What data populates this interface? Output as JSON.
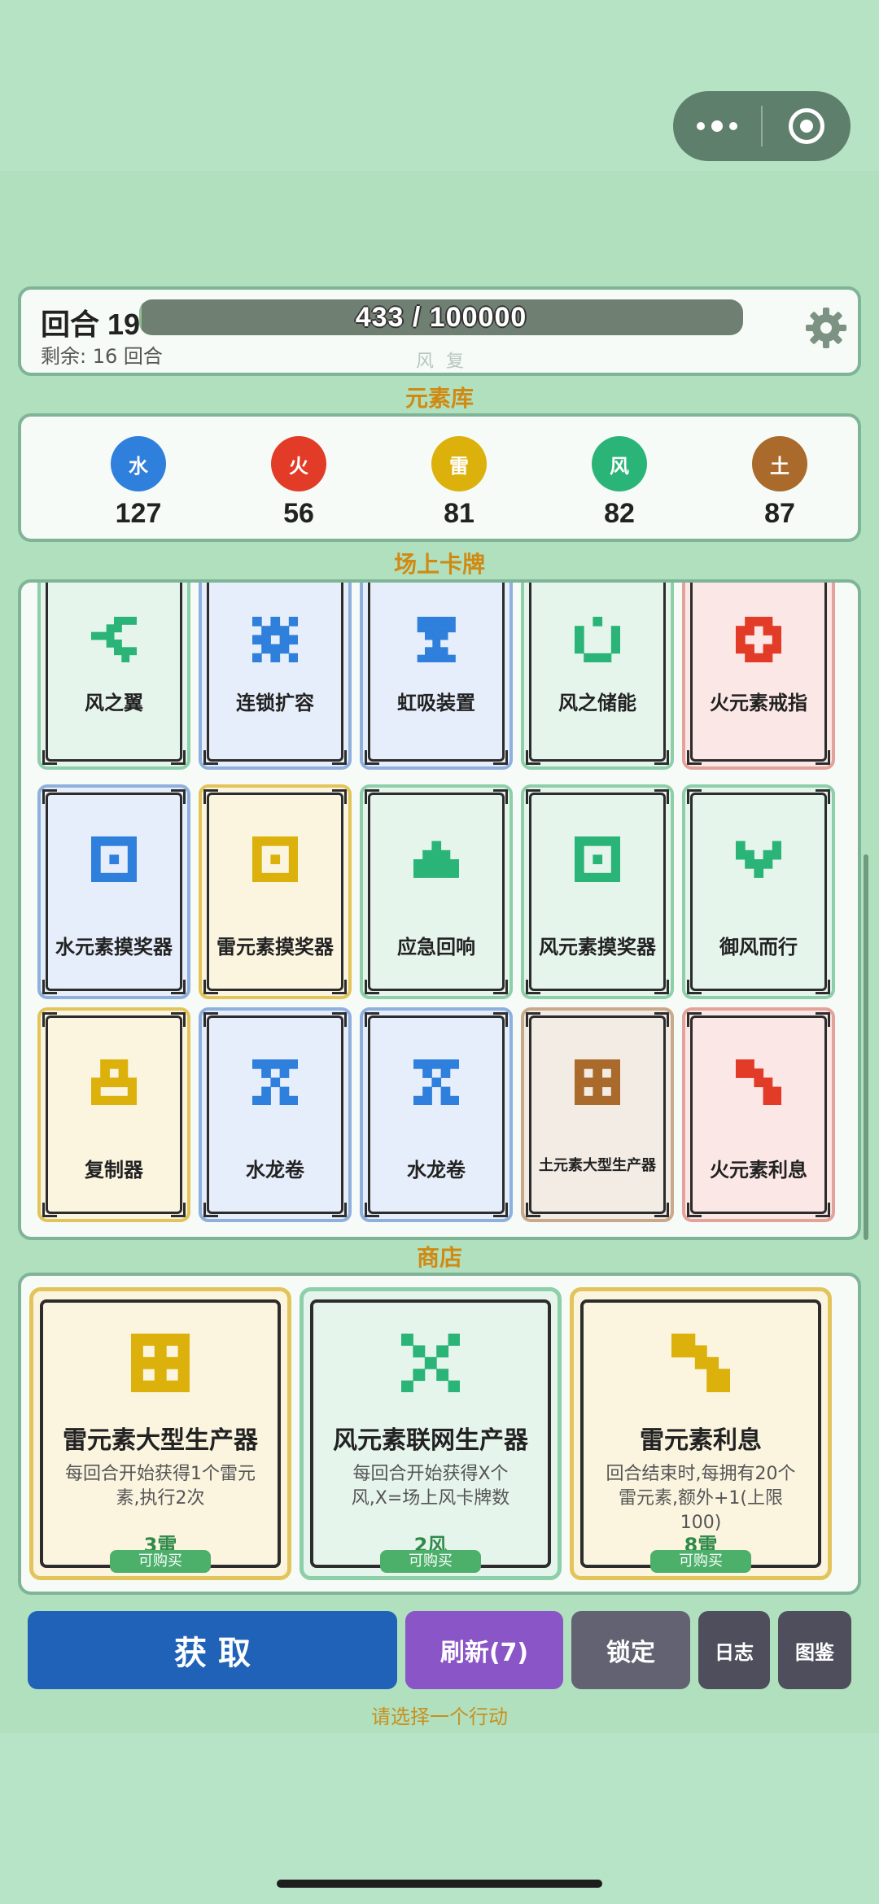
{
  "header": {
    "round_label": "回合 19",
    "remaining": "剩余: 16 回合",
    "progress_text": "433 / 100000",
    "progress_fraction": 0.00433,
    "faint_text": "风 复"
  },
  "sections": {
    "elements": "元素库",
    "board": "场上卡牌",
    "shop": "商店"
  },
  "elements": [
    {
      "label": "水",
      "count": "127",
      "color": "#2f7fdc"
    },
    {
      "label": "火",
      "count": "56",
      "color": "#e23b27"
    },
    {
      "label": "雷",
      "count": "81",
      "color": "#dcb10c"
    },
    {
      "label": "风",
      "count": "82",
      "color": "#2bb477"
    },
    {
      "label": "土",
      "count": "87",
      "color": "#a96a2c"
    }
  ],
  "board_cards": [
    {
      "name": "风之翼",
      "icon": "wing-icon",
      "element": "wind"
    },
    {
      "name": "连锁扩容",
      "icon": "chain-expand-icon",
      "element": "water"
    },
    {
      "name": "虹吸装置",
      "icon": "siphon-icon",
      "element": "water"
    },
    {
      "name": "风之储能",
      "icon": "wind-storage-icon",
      "element": "wind"
    },
    {
      "name": "火元素戒指",
      "icon": "ring-icon",
      "element": "fire"
    },
    {
      "name": "水元素摸奖器",
      "icon": "lottery-box-icon",
      "element": "water"
    },
    {
      "name": "雷元素摸奖器",
      "icon": "lottery-box-icon",
      "element": "thunder"
    },
    {
      "name": "应急回响",
      "icon": "echo-icon",
      "element": "wind"
    },
    {
      "name": "风元素摸奖器",
      "icon": "lottery-box-icon",
      "element": "wind"
    },
    {
      "name": "御风而行",
      "icon": "wind-walk-icon",
      "element": "wind"
    },
    {
      "name": "复制器",
      "icon": "copier-icon",
      "element": "thunder"
    },
    {
      "name": "水龙卷",
      "icon": "waterspout-icon",
      "element": "water"
    },
    {
      "name": "水龙卷",
      "icon": "waterspout-icon",
      "element": "water"
    },
    {
      "name": "土元素大型生产器",
      "icon": "large-generator-icon",
      "element": "earth"
    },
    {
      "name": "火元素利息",
      "icon": "interest-icon",
      "element": "fire"
    }
  ],
  "shop_cards": [
    {
      "name": "雷元素大型生产器",
      "desc": "每回合开始获得1个雷元素,执行2次",
      "price": "3雷",
      "buy_label": "可购买",
      "icon": "large-generator-icon",
      "element": "thunder"
    },
    {
      "name": "风元素联网生产器",
      "desc": "每回合开始获得X个风,X=场上风卡牌数",
      "price": "2风",
      "buy_label": "可购买",
      "icon": "network-generator-icon",
      "element": "wind"
    },
    {
      "name": "雷元素利息",
      "desc": "回合结束时,每拥有20个雷元素,额外+1(上限100)",
      "price": "8雷",
      "buy_label": "可购买",
      "icon": "interest-icon",
      "element": "thunder"
    }
  ],
  "actions": {
    "acquire": "获 取",
    "refresh": "刷新(7)",
    "lock": "锁定",
    "log": "日志",
    "codex": "图鉴"
  },
  "hint": "请选择一个行动",
  "colors": {
    "water": {
      "fg": "#2f7fdc",
      "bg": "#e7eefb",
      "border": "#8fb0de"
    },
    "fire": {
      "fg": "#e23b27",
      "bg": "#fbe7e5",
      "border": "#e3a39a"
    },
    "thunder": {
      "fg": "#dcb10c",
      "bg": "#fbf5e0",
      "border": "#e3c45a"
    },
    "wind": {
      "fg": "#2bb477",
      "bg": "#e6f5ec",
      "border": "#8ccfa9"
    },
    "earth": {
      "fg": "#a96a2c",
      "bg": "#f3ece4",
      "border": "#c9a98a"
    }
  }
}
